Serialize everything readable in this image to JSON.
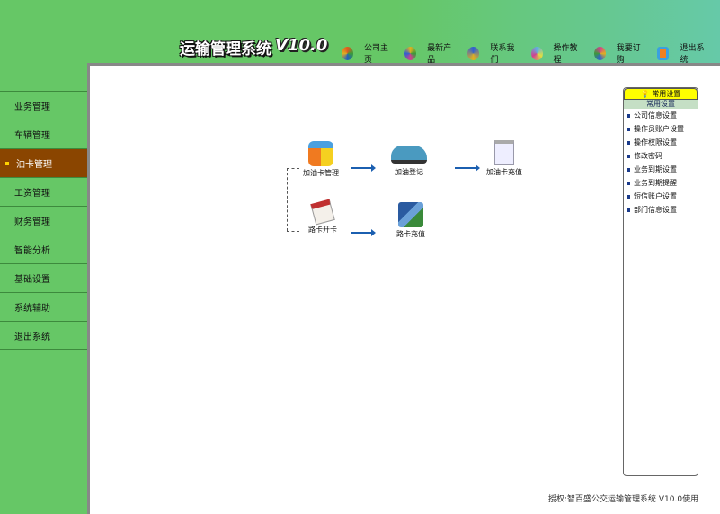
{
  "header": {
    "title": "运输管理系统",
    "version": "V10.0",
    "nav": [
      {
        "label": "公司主页",
        "icon": "home-icon",
        "color": "#e05a20"
      },
      {
        "label": "最新产品",
        "icon": "products-icon",
        "color": "#e0b020"
      },
      {
        "label": "联系我们",
        "icon": "contact-icon",
        "color": "#3060d0"
      },
      {
        "label": "操作教程",
        "icon": "tutorial-icon",
        "color": "#60b0e0"
      },
      {
        "label": "我要订购",
        "icon": "order-icon",
        "color": "#d04090"
      },
      {
        "label": "退出系统",
        "icon": "exit-icon",
        "color": "#f08020"
      }
    ]
  },
  "sidebar": {
    "items": [
      {
        "label": "业务管理"
      },
      {
        "label": "车辆管理"
      },
      {
        "label": "油卡管理",
        "active": true
      },
      {
        "label": "工资管理"
      },
      {
        "label": "财务管理"
      },
      {
        "label": "智能分析"
      },
      {
        "label": "基础设置"
      },
      {
        "label": "系统辅助"
      },
      {
        "label": "退出系统"
      }
    ]
  },
  "flow": {
    "fuel_card_mgmt": "加油卡管理",
    "fuel_register": "加油登记",
    "fuel_card_recharge": "加油卡充值",
    "road_card_open": "路卡开卡",
    "road_card_recharge": "路卡充值"
  },
  "panel": {
    "title": "常用设置",
    "subtitle": "常用设置",
    "items": [
      "公司信息设置",
      "操作员账户设置",
      "操作权限设置",
      "修改密码",
      "业务到期设置",
      "业务到期提醒",
      "短信账户设置",
      "部门信息设置"
    ]
  },
  "footer": {
    "text": "授权:智百盛公交运输管理系统 V10.0使用"
  }
}
